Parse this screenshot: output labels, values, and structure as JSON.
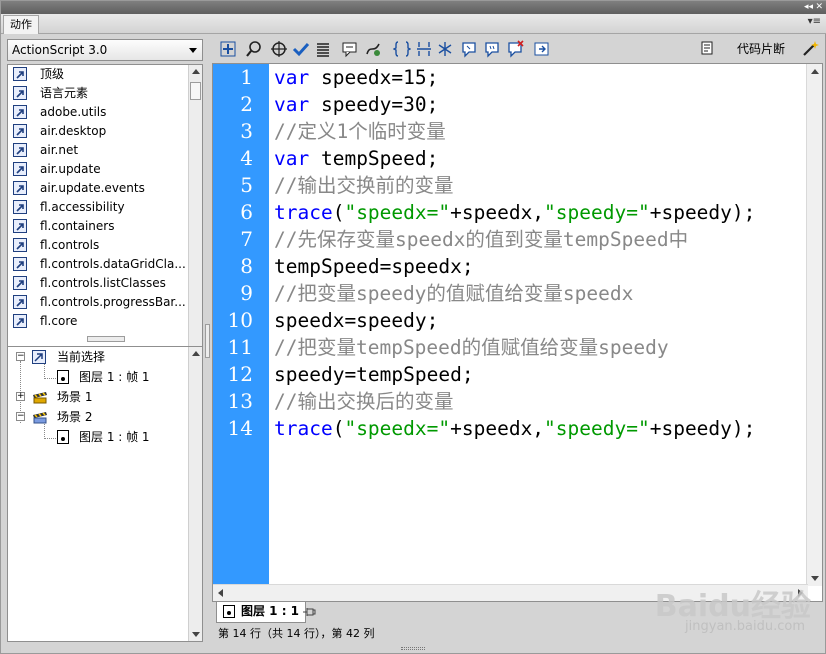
{
  "panel": {
    "title": "动作"
  },
  "language_select": {
    "value": "ActionScript 3.0"
  },
  "packages": [
    "顶级",
    "语言元素",
    "adobe.utils",
    "air.desktop",
    "air.net",
    "air.update",
    "air.update.events",
    "fl.accessibility",
    "fl.containers",
    "fl.controls",
    "fl.controls.dataGridCla...",
    "fl.controls.listClasses",
    "fl.controls.progressBar...",
    "fl.core"
  ],
  "scene_tree": {
    "current_selection": "当前选择",
    "current_layer": "图层 1 : 帧 1",
    "scene1": "场景 1",
    "scene2": "场景 2",
    "scene2_layer": "图层 1 : 帧 1"
  },
  "toolbar": {
    "snippet_label": "代码片断",
    "icons": [
      "add-statement-icon",
      "find-icon",
      "insert-target-path-icon",
      "check-syntax-icon",
      "auto-format-icon",
      "show-code-hint-icon",
      "debug-options-icon",
      "collapse-between-braces-icon",
      "collapse-selection-icon",
      "expand-all-icon",
      "apply-block-comment-icon",
      "apply-line-comment-icon",
      "remove-comment-icon",
      "show-hide-toolbox-icon"
    ]
  },
  "editor": {
    "line_numbers": [
      "1",
      "2",
      "3",
      "4",
      "5",
      "6",
      "7",
      "8",
      "9",
      "10",
      "11",
      "12",
      "13",
      "14"
    ],
    "lines": [
      [
        {
          "t": "var",
          "c": "kw"
        },
        {
          "t": " speedx=15;",
          "c": ""
        }
      ],
      [
        {
          "t": "var",
          "c": "kw"
        },
        {
          "t": " speedy=30;",
          "c": ""
        }
      ],
      [
        {
          "t": "//定义1个临时变量",
          "c": "cm"
        }
      ],
      [
        {
          "t": "var",
          "c": "kw"
        },
        {
          "t": " tempSpeed;",
          "c": ""
        }
      ],
      [
        {
          "t": "//输出交换前的变量",
          "c": "cm"
        }
      ],
      [
        {
          "t": "trace",
          "c": "kw"
        },
        {
          "t": "(",
          "c": ""
        },
        {
          "t": "\"speedx=\"",
          "c": "st"
        },
        {
          "t": "+speedx,",
          "c": ""
        },
        {
          "t": "\"speedy=\"",
          "c": "st"
        },
        {
          "t": "+speedy);",
          "c": ""
        }
      ],
      [
        {
          "t": "//先保存变量speedx的值到变量tempSpeed中",
          "c": "cm"
        }
      ],
      [
        {
          "t": "tempSpeed=speedx;",
          "c": ""
        }
      ],
      [
        {
          "t": "//把变量speedy的值赋值给变量speedx",
          "c": "cm"
        }
      ],
      [
        {
          "t": "speedx=speedy;",
          "c": ""
        }
      ],
      [
        {
          "t": "//把变量tempSpeed的值赋值给变量speedy",
          "c": "cm"
        }
      ],
      [
        {
          "t": "speedy=tempSpeed;",
          "c": ""
        }
      ],
      [
        {
          "t": "//输出交换后的变量",
          "c": "cm"
        }
      ],
      [
        {
          "t": "trace",
          "c": "kw"
        },
        {
          "t": "(",
          "c": ""
        },
        {
          "t": "\"speedx=\"",
          "c": "st"
        },
        {
          "t": "+speedx,",
          "c": ""
        },
        {
          "t": "\"speedy=\"",
          "c": "st"
        },
        {
          "t": "+speedy);",
          "c": ""
        }
      ]
    ]
  },
  "doc_tab": {
    "label": "图层 1 : 1"
  },
  "status": {
    "text": "第 14 行（共 14 行），第 42 列"
  },
  "watermark": {
    "main": "Baidu经验",
    "sub": "jingyan.baidu.com"
  },
  "colors": {
    "gutter": "#3399ff",
    "keyword": "#0000ff",
    "comment": "#888888",
    "string": "#009900"
  }
}
